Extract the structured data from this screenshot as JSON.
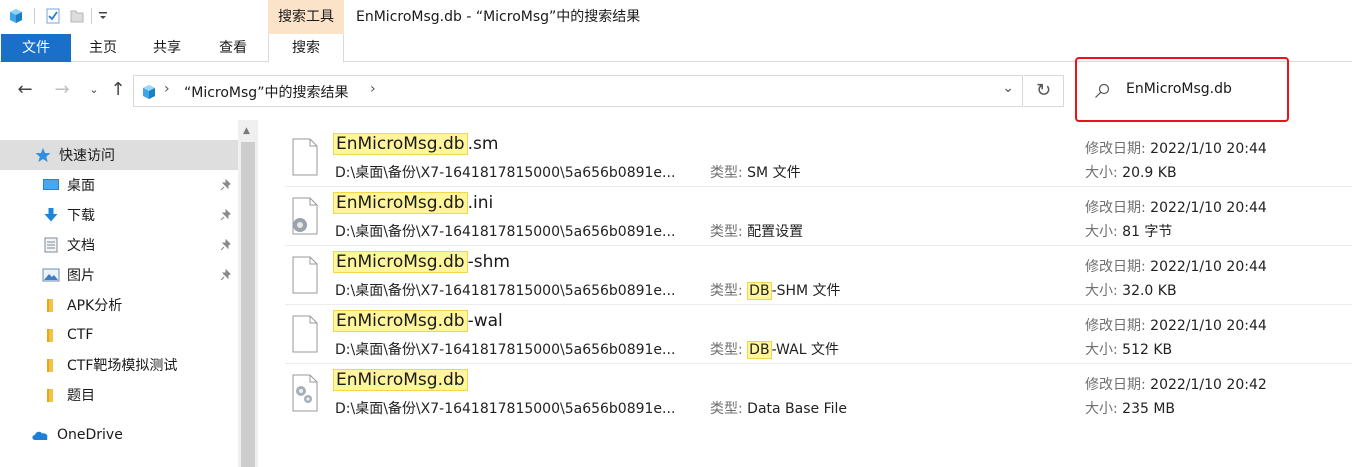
{
  "window": {
    "title": "EnMicroMsg.db - “MicroMsg”中的搜索结果",
    "context_tab_group": "搜索工具"
  },
  "ribbon": {
    "tabs": [
      {
        "label": "文件"
      },
      {
        "label": "主页"
      },
      {
        "label": "共享"
      },
      {
        "label": "查看"
      },
      {
        "label": "搜索"
      }
    ]
  },
  "address_bar": {
    "path": "“MicroMsg”中的搜索结果"
  },
  "search": {
    "value": "EnMicroMsg.db"
  },
  "sidebar": {
    "quick_access": "快速访问",
    "items": [
      {
        "label": "桌面",
        "icon": "desktop-icon",
        "pinned": true
      },
      {
        "label": "下载",
        "icon": "download-icon",
        "pinned": true
      },
      {
        "label": "文档",
        "icon": "documents-icon",
        "pinned": true
      },
      {
        "label": "图片",
        "icon": "pictures-icon",
        "pinned": true
      },
      {
        "label": "APK分析",
        "icon": "folder-icon",
        "pinned": false
      },
      {
        "label": "CTF",
        "icon": "folder-icon",
        "pinned": false
      },
      {
        "label": "CTF靶场模拟测试",
        "icon": "folder-icon",
        "pinned": false
      },
      {
        "label": "题目",
        "icon": "folder-icon",
        "pinned": false
      }
    ],
    "onedrive": "OneDrive"
  },
  "labels": {
    "type": "类型:",
    "modified": "修改日期:",
    "size": "大小:"
  },
  "results": [
    {
      "name_match": "EnMicroMsg.db",
      "name_rest": ".sm",
      "path": "D:\\桌面\\备份\\X7-1641817815000\\5a656b0891e...",
      "type_match": "",
      "type_rest": "SM 文件",
      "modified": "2022/1/10 20:44",
      "size": "20.9 KB",
      "icon": "blank-file-icon"
    },
    {
      "name_match": "EnMicroMsg.db",
      "name_rest": ".ini",
      "path": "D:\\桌面\\备份\\X7-1641817815000\\5a656b0891e...",
      "type_match": "",
      "type_rest": "配置设置",
      "modified": "2022/1/10 20:44",
      "size": "81 字节",
      "icon": "config-file-icon"
    },
    {
      "name_match": "EnMicroMsg.db",
      "name_rest": "-shm",
      "path": "D:\\桌面\\备份\\X7-1641817815000\\5a656b0891e...",
      "type_match": "DB",
      "type_rest": "-SHM 文件",
      "modified": "2022/1/10 20:44",
      "size": "32.0 KB",
      "icon": "blank-file-icon"
    },
    {
      "name_match": "EnMicroMsg.db",
      "name_rest": "-wal",
      "path": "D:\\桌面\\备份\\X7-1641817815000\\5a656b0891e...",
      "type_match": "DB",
      "type_rest": "-WAL 文件",
      "modified": "2022/1/10 20:44",
      "size": "512 KB",
      "icon": "blank-file-icon"
    },
    {
      "name_match": "EnMicroMsg.db",
      "name_rest": "",
      "path": "D:\\桌面\\备份\\X7-1641817815000\\5a656b0891e...",
      "type_match": "",
      "type_rest": "Data Base File",
      "modified": "2022/1/10 20:42",
      "size": "235 MB",
      "icon": "system-file-icon"
    }
  ],
  "colors": {
    "accent": "#1a6fc9",
    "context_tab": "#fbe3c9",
    "highlight": "#fff59b",
    "annotation_box": "#e8131b"
  }
}
